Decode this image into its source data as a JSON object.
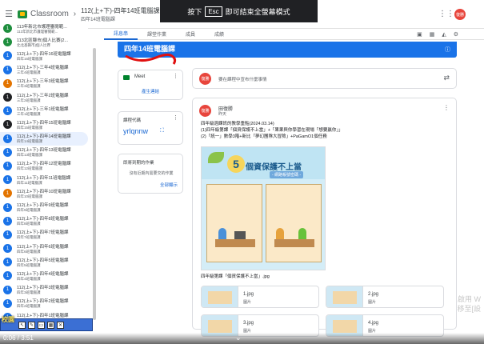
{
  "topbar": {
    "menu_icon": "hamburger-menu-icon",
    "app_name": "Classroom",
    "crumb_sep": "›",
    "class_title": "112(上+下)-四年14班電腦課",
    "class_sub": "四年14班電腦課",
    "grid_icon": "apps-grid-icon",
    "avatar_text": "復勝"
  },
  "esc_banner": {
    "before": "按下",
    "key": "Esc",
    "after": "即可結束全螢幕模式"
  },
  "sidebar": {
    "items": [
      {
        "badge": "1",
        "color": "#1e8e3e",
        "name": "113年新北市護理審閱範...",
        "sub": "113年新北市護理審閱範..."
      },
      {
        "badge": "1",
        "color": "#1e8e3e",
        "name": "113北區縣市)個人比賽(2...",
        "sub": "北北基縣市)個人比賽"
      },
      {
        "badge": "1",
        "color": "#1a73e8",
        "name": "112(上+下)-四年16班電腦課",
        "sub": "四年16班電腦課"
      },
      {
        "badge": "1",
        "color": "#1a73e8",
        "name": "112(上+下)-三年4班電腦課",
        "sub": "三年4班電腦課"
      },
      {
        "badge": "1",
        "color": "#e37400",
        "name": "112(上+下)-三年3班電腦課",
        "sub": "三年3班電腦課"
      },
      {
        "badge": "1",
        "color": "#202124",
        "name": "112(上+下)-三年2班電腦課",
        "sub": "三年2班電腦課"
      },
      {
        "badge": "1",
        "color": "#1a73e8",
        "name": "112(上+下)-三年1班電腦課",
        "sub": "三年1班電腦課"
      },
      {
        "badge": "1",
        "color": "#202124",
        "name": "112(上+下)-四年15班電腦課",
        "sub": "四年15班電腦課"
      },
      {
        "badge": "1",
        "color": "#1a73e8",
        "name": "112(上+下)-四年14班電腦課",
        "sub": "四年14班電腦課",
        "active": true
      },
      {
        "badge": "1",
        "color": "#1a73e8",
        "name": "112(上+下)-四年13班電腦課",
        "sub": "四年13班電腦課"
      },
      {
        "badge": "1",
        "color": "#1a73e8",
        "name": "112(上+下)-四年12班電腦課",
        "sub": "四年12班電腦課"
      },
      {
        "badge": "1",
        "color": "#1a73e8",
        "name": "112(上+下)-四年11班電腦課",
        "sub": "四年11班電腦課"
      },
      {
        "badge": "1",
        "color": "#e37400",
        "name": "112(上+下)-四年10班電腦課",
        "sub": "四年10班電腦課"
      },
      {
        "badge": "1",
        "color": "#1a73e8",
        "name": "112(上+下)-四年9班電腦課",
        "sub": "四年9班電腦課"
      },
      {
        "badge": "1",
        "color": "#1a73e8",
        "name": "112(上+下)-四年8班電腦課",
        "sub": "四年8班電腦課"
      },
      {
        "badge": "1",
        "color": "#1a73e8",
        "name": "112(上+下)-四年7班電腦課",
        "sub": "四年7班電腦課"
      },
      {
        "badge": "1",
        "color": "#1a73e8",
        "name": "112(上+下)-四年6班電腦課",
        "sub": "四年6班電腦課"
      },
      {
        "badge": "1",
        "color": "#1a73e8",
        "name": "112(上+下)-四年5班電腦課",
        "sub": "四年5班電腦課"
      },
      {
        "badge": "1",
        "color": "#1a73e8",
        "name": "112(上+下)-四年4班電腦課",
        "sub": "四年4班電腦課"
      },
      {
        "badge": "1",
        "color": "#1a73e8",
        "name": "112(上+下)-四年3班電腦課",
        "sub": "四年3班電腦課"
      },
      {
        "badge": "1",
        "color": "#1a73e8",
        "name": "112(上+下)-四年2班電腦課",
        "sub": "四年2班電腦課"
      },
      {
        "badge": "1",
        "color": "#1a73e8",
        "name": "112(上+下)-四年1班電腦課",
        "sub": "四年1班電腦課"
      }
    ]
  },
  "tabs": [
    {
      "label": "訊息串",
      "active": true
    },
    {
      "label": "課堂作業"
    },
    {
      "label": "成員"
    },
    {
      "label": "成績"
    }
  ],
  "tab_icons": [
    "google-calendar-icon",
    "calendar-icon",
    "drive-folder-icon",
    "settings-icon",
    "more-vert-icon"
  ],
  "banner": {
    "title": "四年14班電腦課",
    "info_icon": "info-icon"
  },
  "meet": {
    "label": "Meet",
    "link": "產生連結",
    "icon": "meet-icon"
  },
  "class_code": {
    "label": "課程代碼",
    "value": "yrlqnnw",
    "expand_icon": "fullscreen-icon"
  },
  "upcoming": {
    "title": "即將到期的作業",
    "empty": "沒有近期內需要交的作業",
    "link": "全部顯示"
  },
  "announce": {
    "avatar": "復勝",
    "placeholder": "要在課程中宣布什麼事情",
    "icon": "repost-icon"
  },
  "post": {
    "avatar": "復勝",
    "author": "田復勝",
    "date": "昨天",
    "body_lines": [
      "四年級週課訊的教學重點(2024.03.14)",
      "(1)四年級第課「個資保護不上當」+「果果與你學習在現場「想要贏你」」",
      "(2)「統一」數學3階+新比「夢幻團隊大冒險」+PaGamO1個任務"
    ],
    "poster": {
      "number": "5",
      "title": "個資保護不上當",
      "sub": "- 網路帳號密碼 -"
    },
    "caption": "四年級第課「個資保護不上當」.jpg",
    "attachments": [
      {
        "name": "1.jpg",
        "type": "圖片"
      },
      {
        "name": "2.jpg",
        "type": "圖片"
      },
      {
        "name": "3.jpg",
        "type": "圖片"
      },
      {
        "name": "4.jpg",
        "type": "圖片"
      }
    ]
  },
  "watermark": [
    "啟用 W",
    "移至[設"
  ],
  "overlay_toolbar": {
    "label": "校園",
    "buttons": [
      "pointer-icon",
      "pen-icon",
      "eraser-icon",
      "grid-icon",
      "close-icon"
    ]
  },
  "player": {
    "time": "0:06 / 3:51",
    "chevron": "⌄"
  },
  "colors": {
    "accent": "#1a73e8",
    "banner": "#1a73e8",
    "avatar": "#e8453c"
  }
}
